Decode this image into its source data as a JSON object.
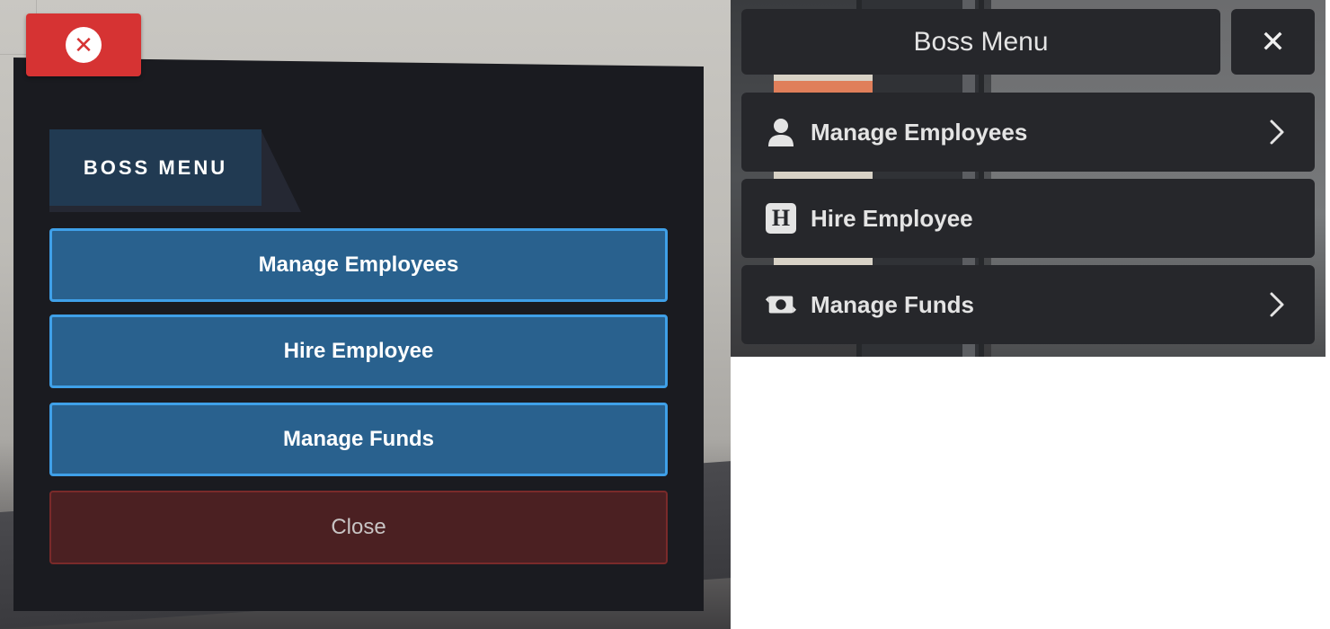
{
  "legacy_menu": {
    "header": "BOSS MENU",
    "buttons": [
      {
        "label": "Manage Employees"
      },
      {
        "label": "Hire Employee"
      },
      {
        "label": "Manage Funds"
      }
    ],
    "close_label": "Close",
    "close_icon": "x-circle-icon",
    "colors": {
      "panel": "#1a1b20",
      "header": "#213a52",
      "button": "#29618e",
      "button_border": "#3fa0e8",
      "close_bg": "#4b2022",
      "x_button": "#d63333"
    }
  },
  "new_menu": {
    "title": "Boss Menu",
    "close_icon": "close-icon",
    "items": [
      {
        "label": "Manage Employees",
        "icon": "user-icon",
        "has_submenu": true
      },
      {
        "label": "Hire Employee",
        "icon": "h-badge-icon",
        "badge": "H",
        "has_submenu": false
      },
      {
        "label": "Manage Funds",
        "icon": "money-exchange-icon",
        "has_submenu": true
      }
    ],
    "colors": {
      "item_bg": "#26272b",
      "text": "#e4e4e4"
    }
  }
}
